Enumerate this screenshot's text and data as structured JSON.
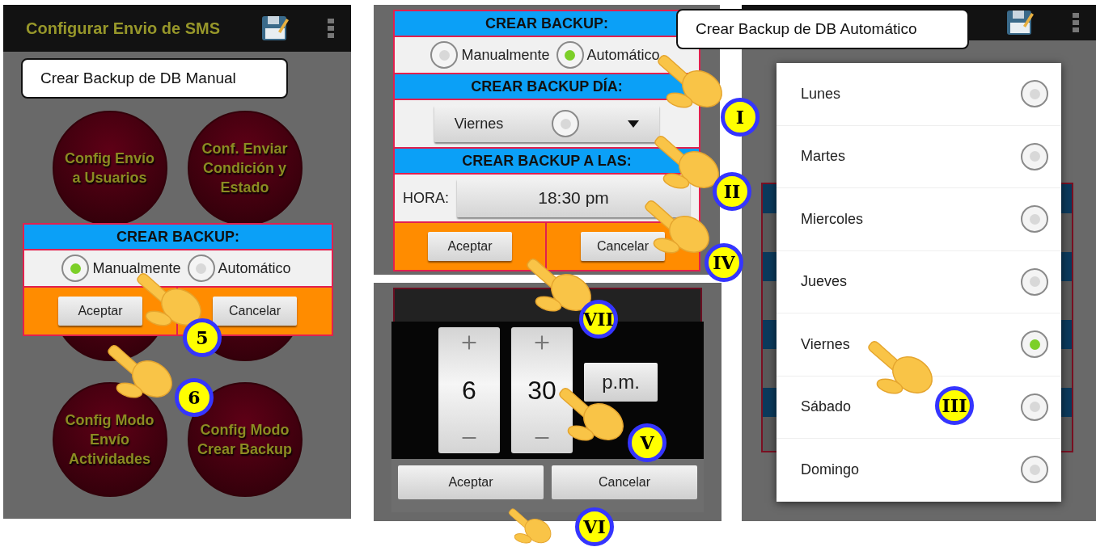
{
  "manual_screen": {
    "app_bar": {
      "title": "Configurar Envio de SMS"
    },
    "menu_buttons": [
      {
        "label": "Config Envío a Usuarios"
      },
      {
        "label": "Conf. Enviar Condición y Estado"
      },
      {
        "label": "Config Modo Envío Actividades"
      },
      {
        "label": "Config Modo Crear Backup"
      }
    ],
    "dialog": {
      "header": "CREAR BACKUP:",
      "options": [
        {
          "label": "Manualmente",
          "selected": true
        },
        {
          "label": "Automático",
          "selected": false
        }
      ],
      "buttons": [
        "Aceptar",
        "Cancelar"
      ]
    }
  },
  "automatic_form": {
    "header": "CREAR BACKUP:",
    "options": [
      {
        "label": "Manualmente",
        "selected": false
      },
      {
        "label": "Automático",
        "selected": true
      }
    ],
    "day_header": "CREAR BACKUP DÍA:",
    "day_value": "Viernes",
    "time_header": "CREAR BACKUP A LAS:",
    "time_label": "HORA:",
    "time_value": "18:30 pm",
    "buttons": [
      "Aceptar",
      "Cancelar"
    ]
  },
  "time_picker": {
    "hour": "6",
    "minute": "30",
    "period": "p.m.",
    "buttons": [
      "Aceptar",
      "Cancelar"
    ]
  },
  "day_picker": {
    "days": [
      {
        "label": "Lunes",
        "selected": false
      },
      {
        "label": "Martes",
        "selected": false
      },
      {
        "label": "Miercoles",
        "selected": false
      },
      {
        "label": "Jueves",
        "selected": false
      },
      {
        "label": "Viernes",
        "selected": true
      },
      {
        "label": "Sábado",
        "selected": false
      },
      {
        "label": "Domingo",
        "selected": false
      }
    ]
  },
  "callouts": [
    {
      "text": "Crear Backup de DB Manual"
    },
    {
      "text": "Crear Backup de DB Automático"
    }
  ],
  "step_markers": [
    {
      "label": "5"
    },
    {
      "label": "6"
    },
    {
      "label": "I"
    },
    {
      "label": "II"
    },
    {
      "label": "IV"
    },
    {
      "label": "VII"
    },
    {
      "label": "V"
    },
    {
      "label": "VI"
    },
    {
      "label": "III"
    }
  ]
}
